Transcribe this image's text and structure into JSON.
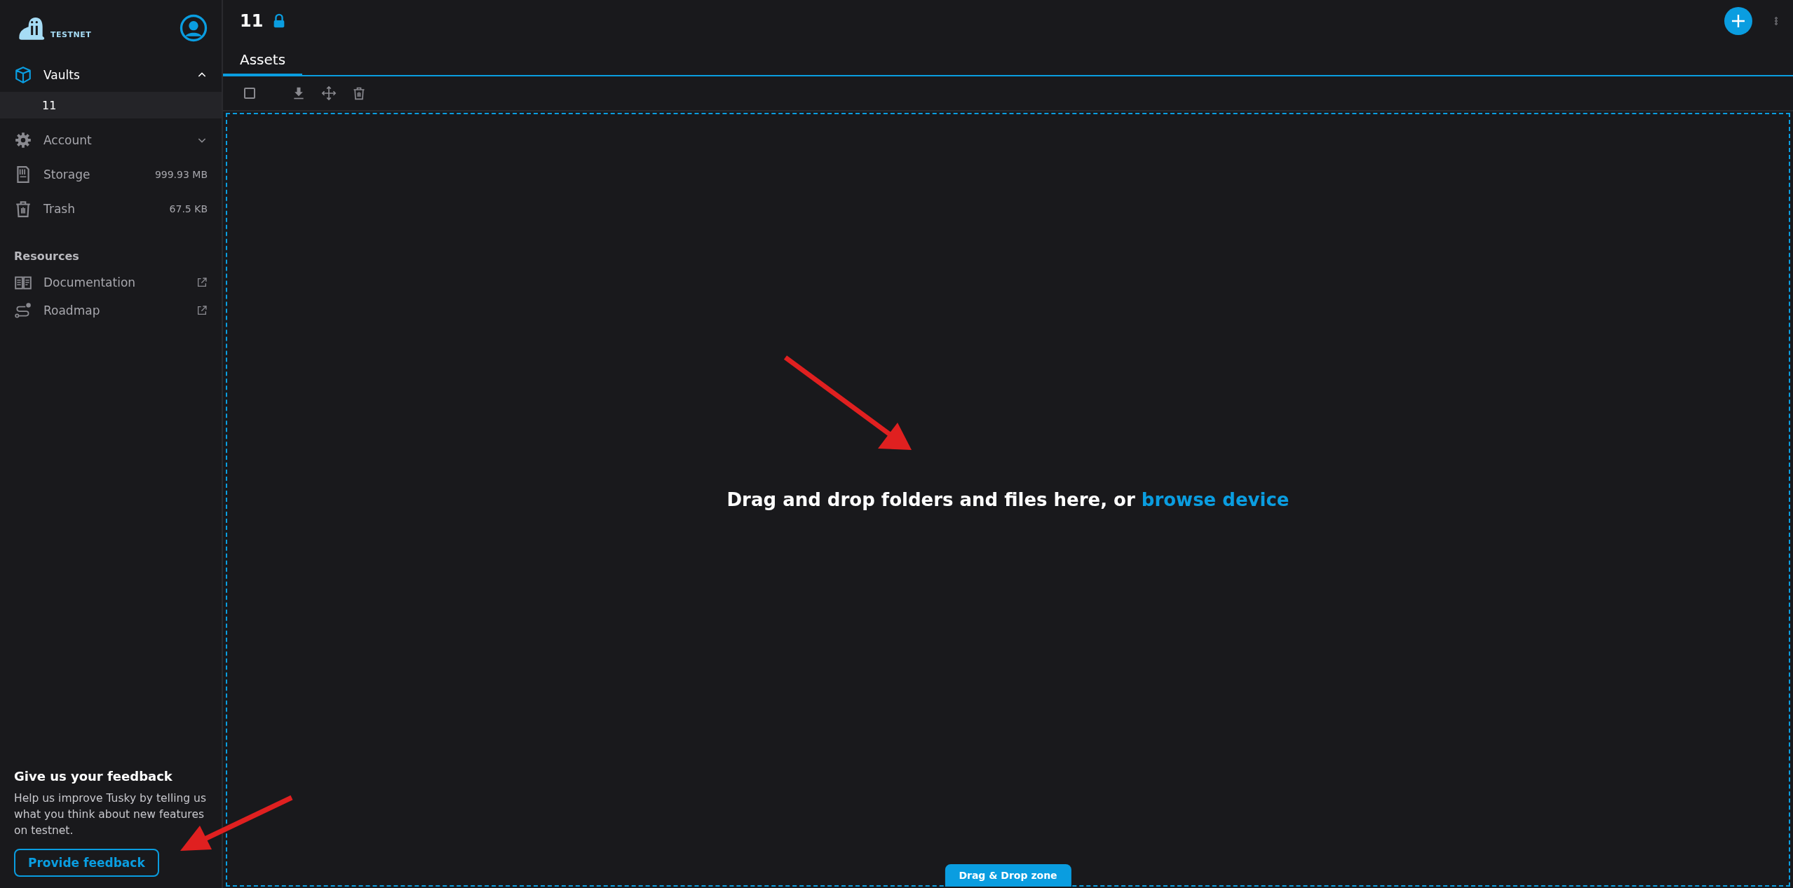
{
  "sidebar": {
    "logo": {
      "badge": "TESTNET"
    },
    "nav": [
      {
        "kind": "group",
        "label": "Vaults",
        "expanded": true,
        "children": [
          {
            "label": "11",
            "selected": true
          }
        ]
      },
      {
        "kind": "group",
        "label": "Account",
        "expanded": false
      },
      {
        "kind": "stat",
        "label": "Storage",
        "value": "999.93 MB"
      },
      {
        "kind": "stat",
        "label": "Trash",
        "value": "67.5 KB"
      }
    ],
    "resources": {
      "heading": "Resources",
      "links": [
        {
          "label": "Documentation"
        },
        {
          "label": "Roadmap"
        }
      ]
    },
    "feedback": {
      "title": "Give us your feedback",
      "text": "Help us improve Tusky by telling us what you think about new features on testnet.",
      "button": "Provide feedback"
    }
  },
  "header": {
    "title": "11",
    "locked": true
  },
  "tabs": [
    {
      "label": "Assets",
      "selected": true
    }
  ],
  "toolbar": {
    "select_all_checked": false
  },
  "dropzone": {
    "text": "Drag and drop folders and files here, or ",
    "link": "browse device",
    "badge": "Drag & Drop zone"
  }
}
